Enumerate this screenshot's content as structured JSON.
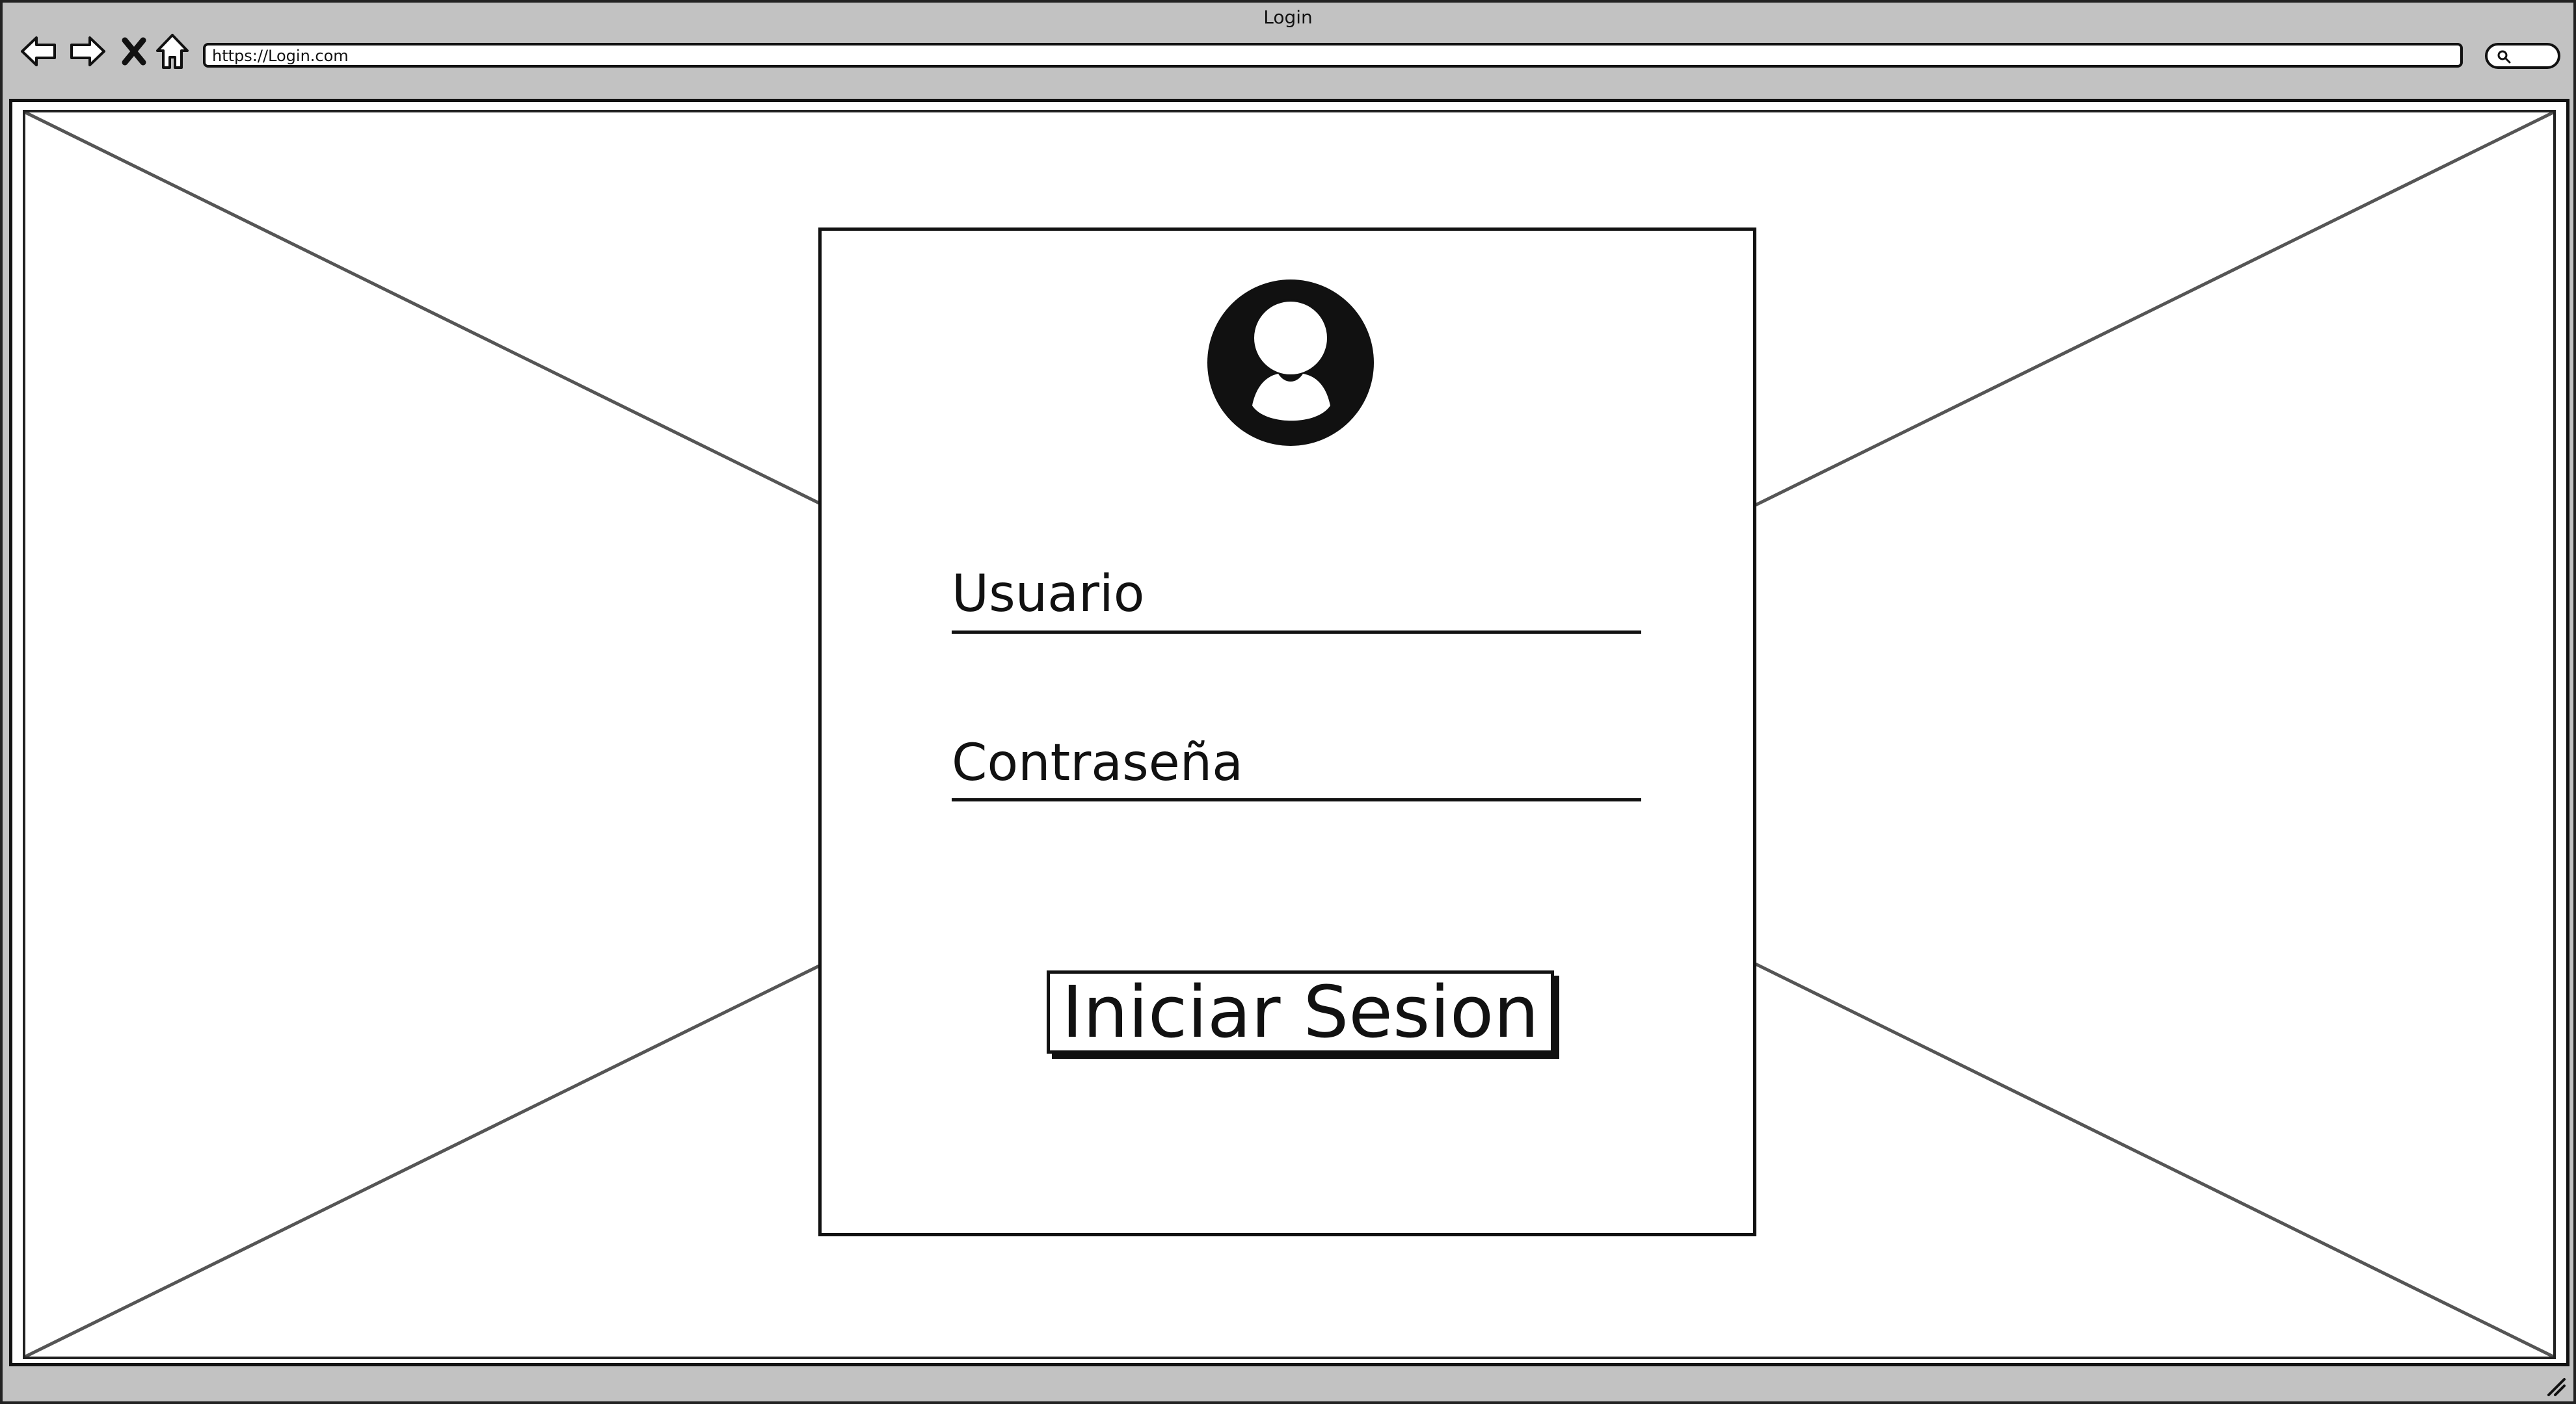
{
  "window": {
    "title": "Login",
    "url": "https://Login.com"
  },
  "toolbar": {
    "icons": [
      "back-icon",
      "forward-icon",
      "stop-icon",
      "home-icon",
      "search-icon"
    ]
  },
  "login": {
    "username_label": "Usuario",
    "password_label": "Contraseña",
    "submit_label": "Iniciar Sesion",
    "avatar_icon": "user-avatar-icon"
  },
  "colors": {
    "chrome": "#c2c2c2",
    "ink": "#111111"
  }
}
